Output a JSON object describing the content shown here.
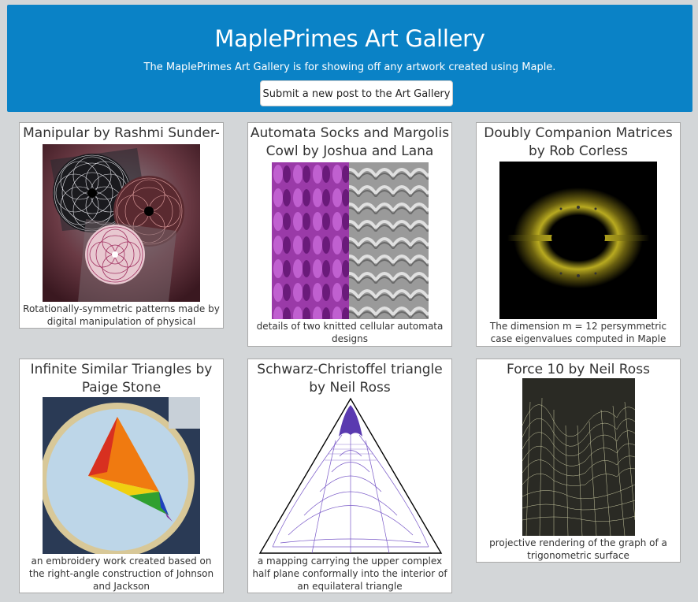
{
  "header": {
    "title": "MaplePrimes Art Gallery",
    "subtitle": "The MaplePrimes Art Gallery is for showing off any artwork created using Maple.",
    "submit_label": "Submit a new post to the Art Gallery"
  },
  "cards": [
    {
      "title": "Manipular by Rashmi Sunder-Raj",
      "caption": "Rotationally-symmetric patterns made by digital manipulation of physical “squiggles”"
    },
    {
      "title": "Automata Socks and Margolis Cowl by Joshua and Lana Holden",
      "caption": "details of two knitted cellular automata designs"
    },
    {
      "title": "Doubly Companion Matrices by Rob Corless",
      "caption": "The dimension m = 12 persymmetric case eigenvalues computed in Maple"
    },
    {
      "title": "Infinite Similar Triangles by Paige Stone",
      "caption": "an embroidery work created based on the right-angle construction of Johnson and Jackson"
    },
    {
      "title": "Schwarz-Christoffel triangle by Neil Ross",
      "caption": "a mapping carrying the upper complex half plane conformally into the interior of an equilateral triangle"
    },
    {
      "title": "Force 10 by Neil Ross",
      "caption": "projective rendering of the graph of a trigonometric surface"
    }
  ]
}
